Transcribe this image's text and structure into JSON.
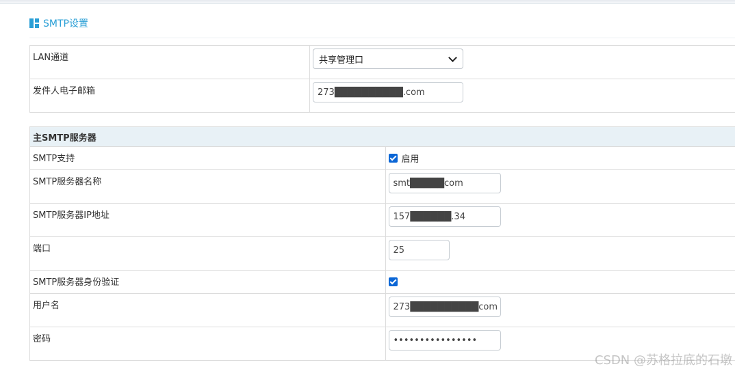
{
  "page": {
    "section_title": "SMTP设置",
    "watermark": "CSDN @苏格拉底的石墩"
  },
  "general": {
    "lan_channel": {
      "label": "LAN通道",
      "value": "共享管理口"
    },
    "sender_email": {
      "label": "发件人电子邮箱",
      "value": "273██████████.com"
    }
  },
  "smtp": {
    "section_title": "主SMTP服务器",
    "support": {
      "label": "SMTP支持",
      "checked": true,
      "option_label": "启用"
    },
    "server_name": {
      "label": "SMTP服务器名称",
      "value": "smt█████com"
    },
    "server_ip": {
      "label": "SMTP服务器IP地址",
      "value": "157██████.34"
    },
    "port": {
      "label": "端口",
      "value": "25"
    },
    "auth": {
      "label": "SMTP服务器身份验证",
      "checked": true
    },
    "username": {
      "label": "用户名",
      "value": "273██████████com"
    },
    "password": {
      "label": "密码",
      "value": "••••••••••••••••"
    }
  },
  "colors": {
    "accent": "#2a9fd6",
    "section_bg": "#e8f1f6",
    "checkbox": "#0b66d6"
  },
  "icons": {
    "section_icon": "grid-icon",
    "select_icon": "chevron-down-icon"
  }
}
